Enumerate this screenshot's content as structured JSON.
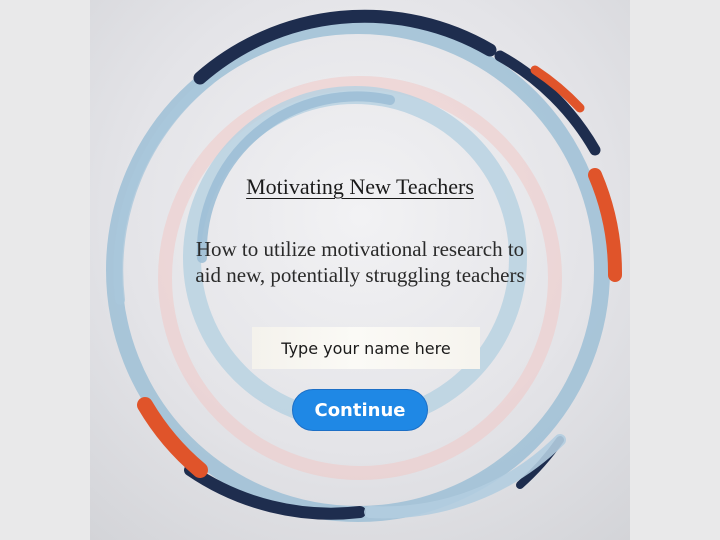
{
  "course": {
    "title": "Motivating New Teachers",
    "subtitle": "How to utilize motivational research to aid new, potentially struggling teachers"
  },
  "name_field": {
    "placeholder": "Type your name here",
    "value": ""
  },
  "continue_button": {
    "label": "Continue"
  },
  "colors": {
    "accent": "#1f88e5",
    "navy": "#1e2d4e",
    "light_blue": "#9dbfd6",
    "orange": "#e0542a",
    "pink": "#f1c9c6"
  }
}
